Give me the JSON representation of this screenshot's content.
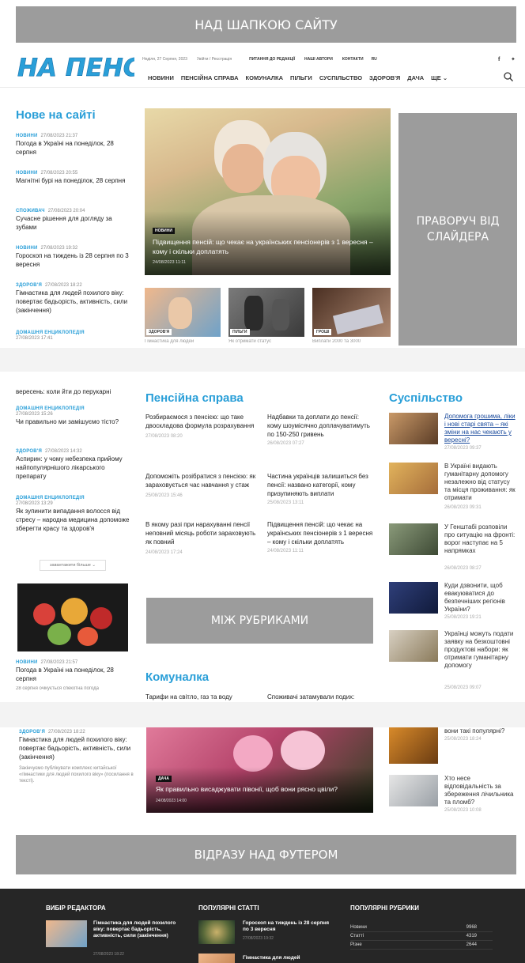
{
  "ads": {
    "top": "НАД ШАПКОЮ САЙТУ",
    "right_slider": "ПРАВОРУЧ ВІД СЛАЙДЕРА",
    "between": "МІЖ РУБРИКАМИ",
    "above_footer": "ВІДРАЗУ НАД ФУТЕРОМ"
  },
  "header": {
    "logo": "НА ПЕНСІЇ",
    "date": "Неділя, 27 Серпня, 2023",
    "login": "Увійти / Реєстрація",
    "top_links": [
      "ПИТАННЯ ДО РЕДАКЦІЇ",
      "НАШІ АВТОРИ",
      "КОНТАКТИ",
      "RU"
    ],
    "social": [
      "f",
      "t"
    ],
    "nav": [
      "НОВИНИ",
      "ПЕНСІЙНА СПРАВА",
      "КОМУНАЛКА",
      "ПІЛЬГИ",
      "СУСПІЛЬСТВО",
      "ЗДОРОВ'Я",
      "ДАЧА",
      "ЩЕ ⌄"
    ]
  },
  "latest": {
    "title": "Нове на сайті",
    "items": [
      {
        "cat": "НОВИНИ",
        "date": "27/08/2023 21:37",
        "title": "Погода в Україні на понеділок, 28 серпня"
      },
      {
        "cat": "НОВИНИ",
        "date": "27/08/2023 20:55",
        "title": "Магнітні бурі на понеділок, 28 серпня"
      },
      {
        "cat": "СПОЖИВАЧ",
        "date": "27/08/2023 20:04",
        "title": "Сучасне рішення для догляду за зубами"
      },
      {
        "cat": "НОВИНИ",
        "date": "27/08/2023 19:32",
        "title": "Гороскоп на тиждень із 28 серпня по 3 вересня"
      },
      {
        "cat": "ЗДОРОВ'Я",
        "date": "27/08/2023 18:22",
        "title": "Гімнастика для людей похилого віку: повертає бадьорість, активність, сили (закінчення)"
      },
      {
        "cat": "ДОМАШНЯ ЕНЦИКЛОПЕДІЯ",
        "date": "27/08/2023 17:41",
        "title": ""
      }
    ]
  },
  "slider": {
    "cat": "НОВИНИ",
    "title": "Підвищення пенсій: що чекає на українських пенсіонерів з 1 вересня – кому і скільки доплатять",
    "date": "24/08/2023 11:11",
    "thumbs": [
      {
        "cat": "ЗДОРОВ'Я",
        "title": "Гімнастика для людей"
      },
      {
        "cat": "ПІЛЬГИ",
        "title": "Як отримати статус"
      },
      {
        "cat": "ГРОШІ",
        "title": "Виплати 2000 та 3000"
      }
    ]
  },
  "left2": {
    "items": [
      {
        "cat": "",
        "date": "",
        "title": "вересень: коли йти до перукарні"
      },
      {
        "cat": "ДОМАШНЯ ЕНЦИКЛОПЕДІЯ",
        "date": "27/08/2023 15:26",
        "title": "Чи правильно ми замішуємо тісто?"
      },
      {
        "cat": "ЗДОРОВ'Я",
        "date": "27/08/2023 14:32",
        "title": "Аспирин: у чому небезпека прийому найпопулярнішого лікарського препарату"
      },
      {
        "cat": "ДОМАШНЯ ЕНЦИКЛОПЕДІЯ",
        "date": "27/08/2023 13:29",
        "title": "Як зупинити випадання волосся від стресу – народна медицина допоможе зберегти красу та здоров'я"
      }
    ],
    "load_more": "завантажити більше ⌄",
    "featured": {
      "cat": "НОВИНИ",
      "date": "27/08/2023 21:57",
      "title": "Погода в Україні на понеділок, 28 серпня",
      "excerpt": "28 серпня очікується спекотна погода"
    }
  },
  "pension": {
    "title": "Пенсійна справа",
    "col1": [
      {
        "title": "Розбираємося з пенсією: що таке двоскладова формула розрахування",
        "date": "27/08/2023 08:20"
      },
      {
        "title": "Допоможіть розібратися з пенсією: як зараховується час навчання у стаж",
        "date": "25/08/2023 15:46"
      },
      {
        "title": "В якому разі при нарахуванні пенсії неповний місяць роботи зараховують як повний",
        "date": "24/08/2023 17:24"
      }
    ],
    "col2": [
      {
        "title": "Надбавки та доплати до пенсії: кому шоумісячно доплачуватимуть по 150-250 гривень",
        "date": "26/08/2023 07:27"
      },
      {
        "title": "Частина українців залишиться без пенсії: названо категорії, кому призупиняють виплати",
        "date": "25/08/2023 13:11"
      },
      {
        "title": "Підвищення пенсій: що чекає на українських пенсіонерів з 1 вересня – кому і скільки доплатять",
        "date": "24/08/2023 11:11"
      }
    ]
  },
  "komunalka": {
    "title": "Комуналка",
    "col1": "Тарифи на світло, газ та воду",
    "col2": "Споживачі затамували подих:"
  },
  "society": {
    "title": "Суспільство",
    "items": [
      {
        "title": "Допомога грошима, ліки і нові старі свята – які зміни на нас чекають у вересні?",
        "date": "27/08/2023 09:37"
      },
      {
        "title": "В Україні видають гуманітарну допомогу незалежно від статусу та місця проживання: як отримати",
        "date": "26/08/2023 09:31"
      },
      {
        "title": "У Генштабі розповіли про ситуацію на фронті: ворог наступає на 5 напрямках",
        "date": "26/08/2023 08:27"
      },
      {
        "title": "Куди дзвонити, щоб евакуюватися до безпечніших регіонів України?",
        "date": "25/08/2023 19:21"
      },
      {
        "title": "Українці можуть подати заявку на безкоштовні продуктові набори: як отримати гуманітарну допомогу",
        "date": "25/08/2023 09:07"
      }
    ]
  },
  "section3": {
    "left": {
      "cat": "ЗДОРОВ'Я",
      "date": "27/08/2023 18:22",
      "title": "Гімнастика для людей похилого віку: повертає бадьорість, активність, сили (закінчення)",
      "excerpt": "Закінчуємо публікувати комплекс китайської «гімнастики для людей похилого віку» (посилання в тексті)."
    },
    "center": {
      "cat": "ДАЧА",
      "title": "Як правильно висаджувати півонії, щоб вони рясно цвіли?",
      "date": "24/08/2023 14:00"
    },
    "right": [
      {
        "title": "вони такі популярні?",
        "date": "25/08/2023 18:24"
      },
      {
        "title": "Хто несе відповідальність за збереження лічильника та пломб?",
        "date": "25/08/2023 10:08"
      }
    ]
  },
  "footer": {
    "editor_pick": {
      "head": "ВИБІР РЕДАКТОРА",
      "title": "Гімнастика для людей похилого віку: повертає бадьорість, активність, сили (закінчення)",
      "date": "27/08/2023 18:22"
    },
    "popular": {
      "head": "ПОПУЛЯРНІ СТАТТІ",
      "items": [
        {
          "title": "Гороскоп на тиждень із 28 серпня по 3 вересня",
          "date": "27/08/2023 19:32"
        },
        {
          "title": "Гімнастика для людей",
          "date": ""
        }
      ]
    },
    "rubrics": {
      "head": "ПОПУЛЯРНІ РУБРИКИ",
      "rows": [
        {
          "name": "Новини",
          "count": "9968"
        },
        {
          "name": "Статті",
          "count": "4319"
        },
        {
          "name": "Різне",
          "count": "2644"
        }
      ]
    }
  }
}
